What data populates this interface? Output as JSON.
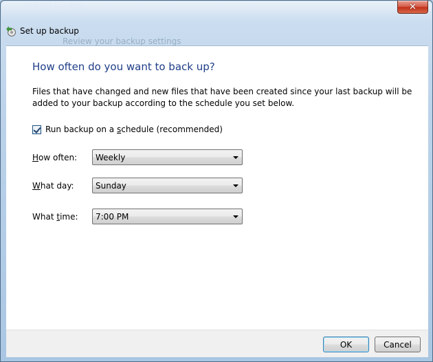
{
  "window": {
    "title": "Set up backup",
    "ghost_title": "Set up backup",
    "ghost_subtitle": "Review your backup settings",
    "close_label": "✕"
  },
  "main": {
    "heading": "How often do you want to back up?",
    "description": "Files that have changed and new files that have been created since your last backup will be added to your backup according to the schedule you set below.",
    "schedule_checkbox": {
      "label_pre": "Run backup on a ",
      "label_accel": "s",
      "label_post": "chedule (recommended)",
      "checked": true
    },
    "how_often": {
      "label_accel": "H",
      "label_rest": "ow often:",
      "value": "Weekly"
    },
    "what_day": {
      "label_accel": "W",
      "label_rest": "hat day:",
      "value": "Sunday"
    },
    "what_time": {
      "label_pre": "What ",
      "label_accel": "t",
      "label_rest": "ime:",
      "value": "7:00 PM"
    }
  },
  "footer": {
    "ok_label": "OK",
    "cancel_label": "Cancel"
  },
  "colors": {
    "heading": "#1e3d87",
    "close": "#c0311a"
  },
  "icons": {
    "app": "backup-icon",
    "close": "close-icon",
    "dropdown": "chevron-down-icon"
  }
}
